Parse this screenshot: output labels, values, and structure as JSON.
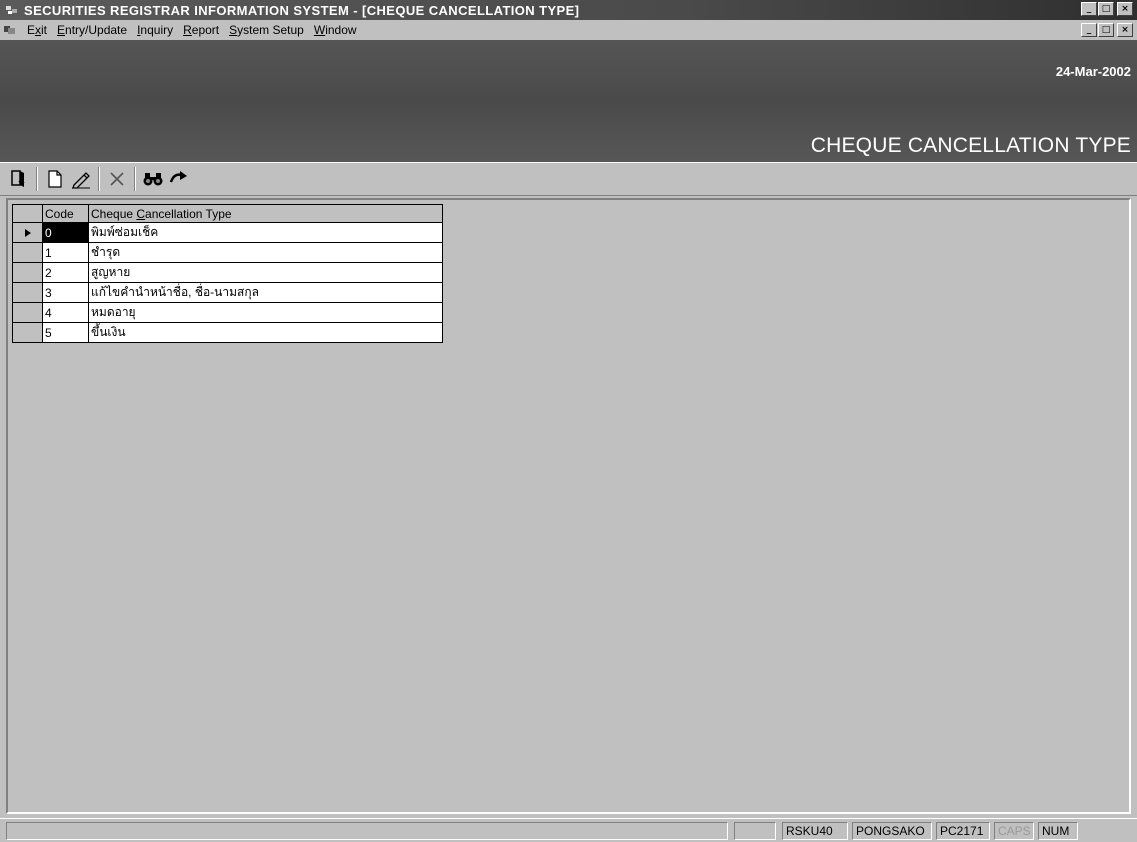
{
  "window": {
    "title": "SECURITIES REGISTRAR INFORMATION SYSTEM - [CHEQUE CANCELLATION TYPE]",
    "minimize_glyph": "_",
    "maximize_glyph": "□",
    "close_glyph": "×"
  },
  "menu": {
    "items": [
      {
        "pre": "E",
        "ul": "x",
        "post": "it"
      },
      {
        "pre": "",
        "ul": "E",
        "post": "ntry/Update"
      },
      {
        "pre": "",
        "ul": "I",
        "post": "nquiry"
      },
      {
        "pre": "",
        "ul": "R",
        "post": "eport"
      },
      {
        "pre": "",
        "ul": "S",
        "post": "ystem Setup"
      },
      {
        "pre": "",
        "ul": "W",
        "post": "indow"
      }
    ]
  },
  "banner": {
    "date": "24-Mar-2002",
    "title": "CHEQUE CANCELLATION TYPE"
  },
  "toolbar": {
    "icons": [
      "exit-door-icon",
      "new-document-icon",
      "edit-pencil-icon",
      "delete-x-icon",
      "find-binoculars-icon",
      "go-arrow-icon"
    ]
  },
  "grid": {
    "header_code": "Code",
    "header_type_pre": "Cheque ",
    "header_type_ul": "C",
    "header_type_post": "ancellation Type",
    "rows": [
      {
        "code": "0",
        "type": "พิมพ์ซ่อมเช็ค"
      },
      {
        "code": "1",
        "type": "ชำรุด"
      },
      {
        "code": "2",
        "type": "สูญหาย"
      },
      {
        "code": "3",
        "type": "แก้ไขคำนำหน้าชื่อ, ชื่อ-นามสกุล"
      },
      {
        "code": "4",
        "type": "หมดอายุ"
      },
      {
        "code": "5",
        "type": "ขึ้นเงิน"
      }
    ]
  },
  "status": {
    "panes": [
      "RSKU40",
      "PONGSAKO",
      "PC2171",
      "CAPS",
      "NUM"
    ]
  }
}
